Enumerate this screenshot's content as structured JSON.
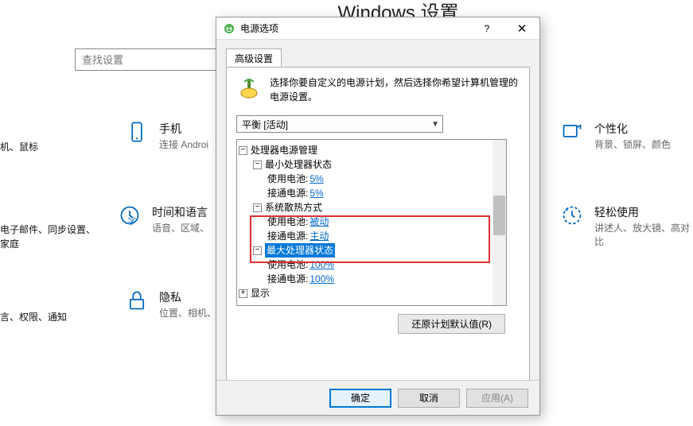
{
  "settings": {
    "title": "Windows 设置",
    "search_placeholder": "查找设置",
    "left_labels": {
      "l1": "机、鼠标",
      "l2": "电子邮件、同步设置、家庭",
      "l3": "言、权限、通知"
    },
    "cats": {
      "phone": {
        "title": "手机",
        "sub": "连接 Androi"
      },
      "time": {
        "title": "时间和语言",
        "sub": "语音、区域、"
      },
      "privacy": {
        "title": "隐私",
        "sub": "位置、相机、"
      },
      "personal": {
        "title": "个性化",
        "sub": "背景、锁屏、颜色"
      },
      "ease": {
        "title": "轻松使用",
        "sub": "讲述人、放大镜、高对比"
      }
    }
  },
  "dialog": {
    "title": "电源选项",
    "help": "?",
    "close": "✕",
    "tab": "高级设置",
    "description": "选择你要自定义的电源计划，然后选择你希望计算机管理的电源设置。",
    "plan_selected": "平衡 [活动]",
    "tree": {
      "n0": {
        "ex": "−",
        "label": "处理器电源管理"
      },
      "n1": {
        "ex": "−",
        "label": "最小处理器状态"
      },
      "n1a": {
        "label": "使用电池: ",
        "val": "5%"
      },
      "n1b": {
        "label": "接通电源: ",
        "val": "5%"
      },
      "n2": {
        "ex": "−",
        "label": "系统散热方式"
      },
      "n2a": {
        "label": "使用电池: ",
        "val": "被动"
      },
      "n2b": {
        "label": "接通电源: ",
        "val": "主动"
      },
      "n3": {
        "ex": "−",
        "label": "最大处理器状态"
      },
      "n3a": {
        "label": "使用电池: ",
        "val": "100%"
      },
      "n3b": {
        "label": "接通电源: ",
        "val": "100%"
      },
      "n4": {
        "ex": "+",
        "label": "显示"
      }
    },
    "restore": "还原计划默认值(R)",
    "ok": "确定",
    "cancel": "取消",
    "apply": "应用(A)"
  }
}
